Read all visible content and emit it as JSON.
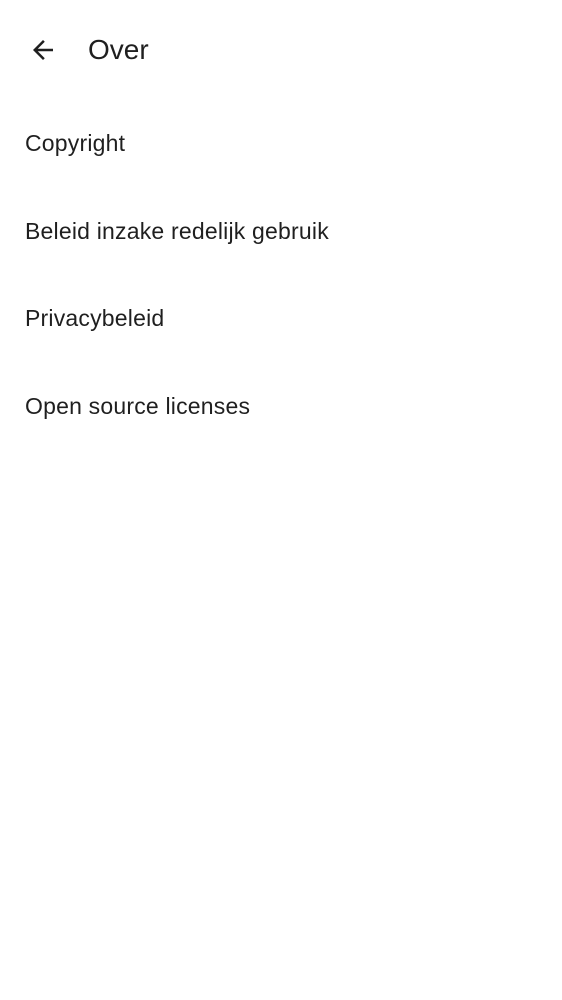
{
  "header": {
    "title": "Over",
    "back_icon": "arrow-back-icon"
  },
  "menu": {
    "items": [
      {
        "id": "copyright",
        "label": "Copyright"
      },
      {
        "id": "fair-use-policy",
        "label": "Beleid inzake redelijk gebruik"
      },
      {
        "id": "privacy-policy",
        "label": "Privacybeleid"
      },
      {
        "id": "open-source-licenses",
        "label": "Open source licenses"
      }
    ]
  },
  "colors": {
    "background": "#ffffff",
    "text": "#1f1f1f"
  }
}
